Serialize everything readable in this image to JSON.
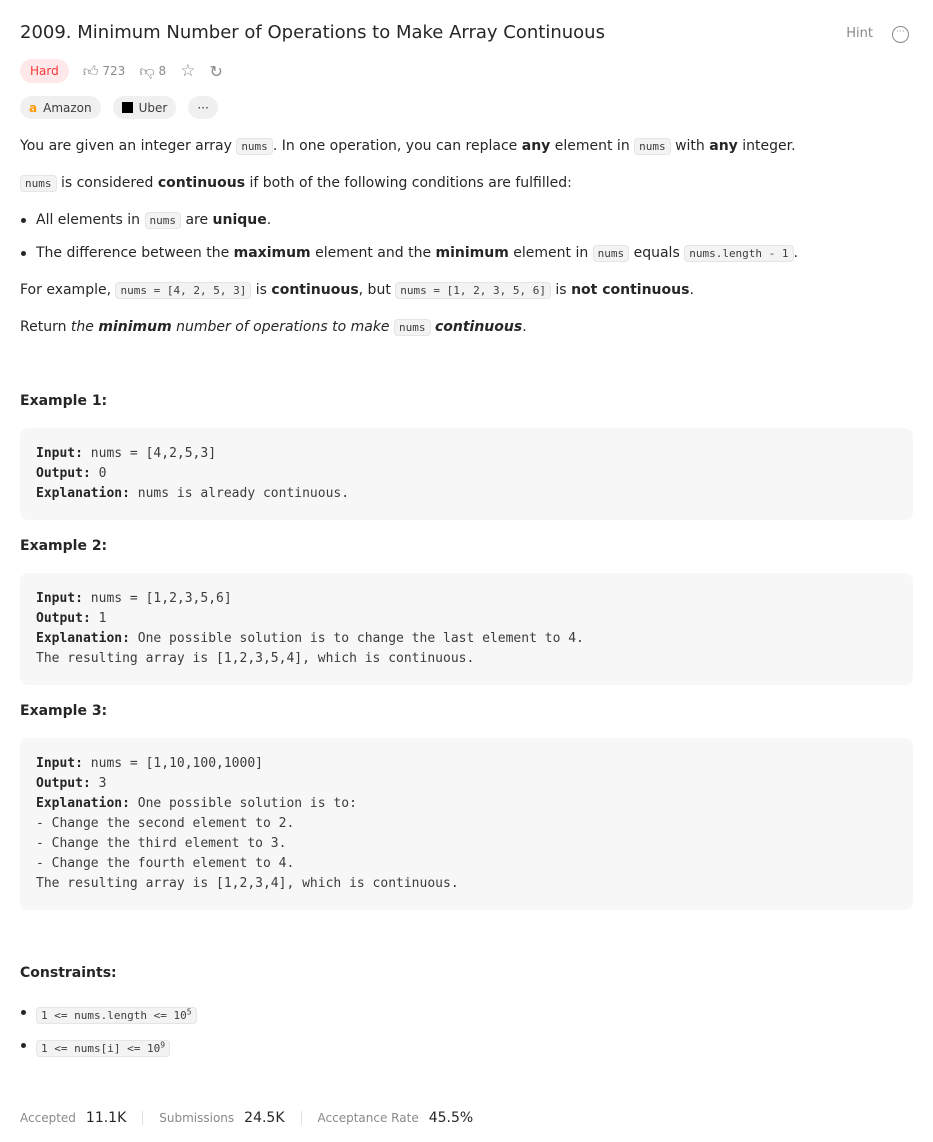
{
  "header": {
    "title": "2009. Minimum Number of Operations to Make Array Continuous",
    "hint_label": "Hint",
    "more_label": "···"
  },
  "meta": {
    "difficulty": "Hard",
    "likes": "723",
    "dislikes": "8"
  },
  "tags": {
    "amazon": "Amazon",
    "uber": "Uber",
    "more": "···"
  },
  "description": [
    [
      {
        "t": "You are given an integer array "
      },
      {
        "c": "nums"
      },
      {
        "t": ". In one operation, you can replace "
      },
      {
        "b": "any"
      },
      {
        "t": " element in "
      },
      {
        "c": "nums"
      },
      {
        "t": " with "
      },
      {
        "b": "any"
      },
      {
        "t": " integer."
      }
    ],
    [
      {
        "c": "nums"
      },
      {
        "t": " is considered "
      },
      {
        "b": "continuous"
      },
      {
        "t": " if both of the following conditions are fulfilled:"
      }
    ],
    [
      {
        "t": "All elements in "
      },
      {
        "c": "nums"
      },
      {
        "t": " are "
      },
      {
        "b": "unique"
      },
      {
        "t": "."
      }
    ],
    [
      {
        "t": "The difference between the "
      },
      {
        "b": "maximum"
      },
      {
        "t": " element and the "
      },
      {
        "b": "minimum"
      },
      {
        "t": " element in "
      },
      {
        "c": "nums"
      },
      {
        "t": " equals "
      },
      {
        "c": "nums.length - 1"
      },
      {
        "t": "."
      }
    ],
    [
      {
        "t": "For example, "
      },
      {
        "c": "nums = [4, 2, 5, 3]"
      },
      {
        "t": " is "
      },
      {
        "b": "continuous"
      },
      {
        "t": ", but "
      },
      {
        "c": "nums = [1, 2, 3, 5, 6]"
      },
      {
        "t": " is "
      },
      {
        "b": "not continuous"
      },
      {
        "t": "."
      }
    ],
    [
      {
        "t": "Return "
      },
      {
        "i": "the "
      },
      {
        "bi": "minimum"
      },
      {
        "i": " number of operations to make "
      },
      {
        "c": "nums"
      },
      {
        "t": " "
      },
      {
        "bi": "continuous"
      },
      {
        "t": "."
      }
    ]
  ],
  "examples": [
    {
      "heading": "Example 1:",
      "lines": [
        [
          "Input:",
          "nums = [4,2,5,3]"
        ],
        [
          "Output:",
          "0"
        ],
        [
          "Explanation:",
          "nums is already continuous."
        ]
      ]
    },
    {
      "heading": "Example 2:",
      "lines": [
        [
          "Input:",
          "nums = [1,2,3,5,6]"
        ],
        [
          "Output:",
          "1"
        ],
        [
          "Explanation:",
          "One possible solution is to change the last element to 4."
        ],
        [
          "",
          "The resulting array is [1,2,3,5,4], which is continuous."
        ]
      ]
    },
    {
      "heading": "Example 3:",
      "lines": [
        [
          "Input:",
          "nums = [1,10,100,1000]"
        ],
        [
          "Output:",
          "3"
        ],
        [
          "Explanation:",
          "One possible solution is to:"
        ],
        [
          "",
          "- Change the second element to 2."
        ],
        [
          "",
          "- Change the third element to 3."
        ],
        [
          "",
          "- Change the fourth element to 4."
        ],
        [
          "",
          "The resulting array is [1,2,3,4], which is continuous."
        ]
      ]
    }
  ],
  "constraints": {
    "heading": "Constraints:",
    "items": [
      {
        "text": "1 <= nums.length <= 10",
        "sup": "5"
      },
      {
        "text": "1 <= nums[i] <= 10",
        "sup": "9"
      }
    ]
  },
  "footer": {
    "accepted_label": "Accepted",
    "accepted": "11.1K",
    "submissions_label": "Submissions",
    "submissions": "24.5K",
    "rate_label": "Acceptance Rate",
    "rate": "45.5%"
  }
}
